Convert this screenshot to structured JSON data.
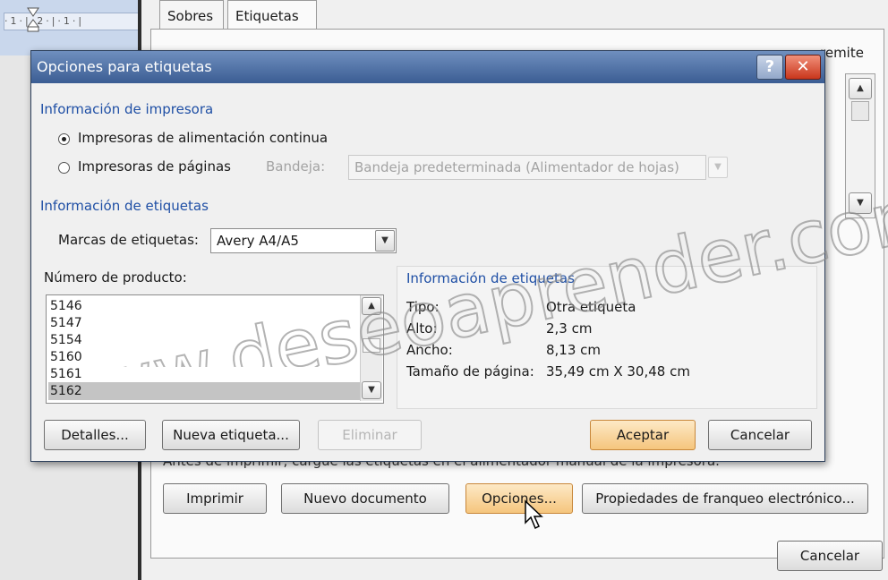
{
  "background": {
    "ruler_text": "·1·|·2·|·1·|",
    "tabs": [
      "Sobres",
      "Etiquetas"
    ],
    "remite_label": "remite",
    "partial_text": "Antes de imprimir, cargue las etiquetas en el alimentador manual de la impresora.",
    "buttons": {
      "print": "Imprimir",
      "new_document": "Nuevo documento",
      "options": "Opciones...",
      "postage_properties": "Propiedades de franqueo electrónico...",
      "cancel": "Cancelar"
    }
  },
  "dialog": {
    "title": "Opciones para etiquetas",
    "help": "?",
    "close": "✕",
    "printer_info": {
      "heading": "Información de impresora",
      "continuous_label": "Impresoras de alimentación continua",
      "page_label": "Impresoras de páginas",
      "tray_label": "Bandeja:",
      "tray_value": "Bandeja predeterminada (Alimentador de hojas)"
    },
    "label_info": {
      "heading": "Información de etiquetas",
      "brand_label": "Marcas de etiquetas:",
      "brand_value": "Avery A4/A5",
      "product_number_label": "Número de producto:",
      "products": [
        "5146",
        "5147",
        "5154",
        "5160",
        "5161",
        "5162"
      ],
      "selected_product": "5162"
    },
    "details": {
      "heading": "Información de etiquetas",
      "type_label": "Tipo:",
      "type_value": "Otra etiqueta",
      "height_label": "Alto:",
      "height_value": "2,3 cm",
      "width_label": "Ancho:",
      "width_value": "8,13 cm",
      "page_size_label": "Tamaño de página:",
      "page_size_value": "35,49 cm X 30,48 cm"
    },
    "buttons": {
      "details": "Detalles...",
      "new_label": "Nueva etiqueta...",
      "delete": "Eliminar",
      "ok": "Aceptar",
      "cancel": "Cancelar"
    }
  },
  "watermark": "www.deseoaprender.com",
  "icons": {
    "scroll_up": "scroll-up-icon",
    "scroll_down": "scroll-down-icon",
    "dropdown": "chevron-down-icon",
    "cursor": "mouse-pointer-icon"
  }
}
